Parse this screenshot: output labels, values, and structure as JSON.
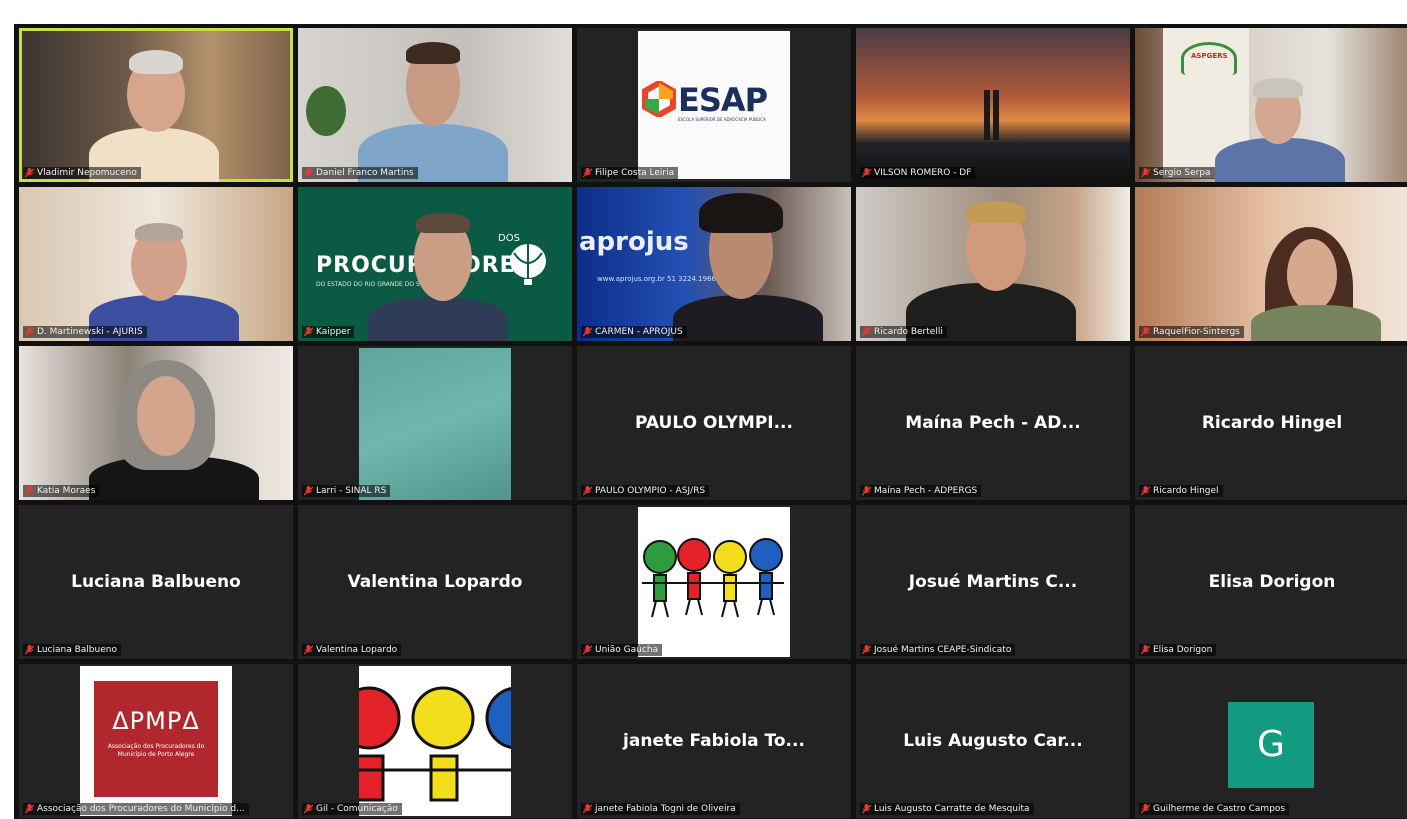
{
  "colors": {
    "background": "#111111",
    "tile": "#232323",
    "active_speaker_border": "#c9dd45",
    "mic_muted": "#e23b2e",
    "apmpa_red": "#b0282e",
    "avatar_green": "#139b82"
  },
  "tiles": [
    {
      "label": "Vladimir Nepomuceno"
    },
    {
      "label": "Daniel Franco Martins"
    },
    {
      "label": "Filipe Costa Leiria",
      "logo_text": "ESAP",
      "logo_subtext": "ESCOLA SUPERIOR DE ADVOCACIA PÚBLICA"
    },
    {
      "label": "VILSON ROMERO - DF"
    },
    {
      "label": "Sergio Serpa",
      "logo_text": "ASPGERS"
    },
    {
      "label": "D. Martinewski - AJURIS"
    },
    {
      "label": "Kaipper",
      "logo_text": "PROCURADORES",
      "logo_subtext": "DO ESTADO DO RIO GRANDE DO SUL · APERGS",
      "logo_prefix": "DOS"
    },
    {
      "label": "CARMEN - APROJUS",
      "logo_text": "aprojus",
      "logo_subtext": "www.aprojus.org.br  51 3224.1966 | 51 99..."
    },
    {
      "label": "Ricardo Bertelli"
    },
    {
      "label": "RaquelFior-Sintergs"
    },
    {
      "label": "Katia Moraes"
    },
    {
      "label": "Larri - SINAL RS"
    },
    {
      "label": "PAULO OLYMPIO - ASJ/RS",
      "display_name": "PAULO OLYMPI..."
    },
    {
      "label": "Maína Pech - ADPERGS",
      "display_name": "Maína Pech - AD..."
    },
    {
      "label": "Ricardo Hingel",
      "display_name": "Ricardo Hingel"
    },
    {
      "label": "Luciana Balbueno",
      "display_name": "Luciana Balbueno"
    },
    {
      "label": "Valentina Lopardo",
      "display_name": "Valentina Lopardo"
    },
    {
      "label": "União Gaúcha"
    },
    {
      "label": "Josué Martins CEAPE-Sindicato",
      "display_name": "Josué Martins C..."
    },
    {
      "label": "Elisa Dorigon",
      "display_name": "Elisa Dorigon"
    },
    {
      "label": "Associação dos Procuradores do Município d...",
      "logo_text": "ΔPMPΔ",
      "logo_subtext": "Associação dos Procuradores do Município de Porto Alegre"
    },
    {
      "label": "Gil - Comunicação"
    },
    {
      "label": "janete Fabiola Togni de Oliveira",
      "display_name": "janete Fabiola To..."
    },
    {
      "label": "Luis Augusto Carratte de Mesquita",
      "display_name": "Luis Augusto Car..."
    },
    {
      "label": "Guilherme de Castro Campos",
      "avatar_letter": "G"
    }
  ]
}
